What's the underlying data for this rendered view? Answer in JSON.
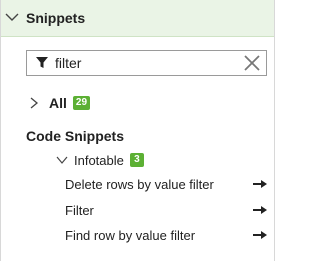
{
  "panel": {
    "title": "Snippets",
    "accent_color": "#5cb034",
    "header_bg": "#eaf4e6"
  },
  "search": {
    "value": "filter",
    "icon": "filter-icon",
    "clear_icon": "close-icon"
  },
  "all": {
    "label": "All",
    "count": "29"
  },
  "code_snippets": {
    "title": "Code Snippets",
    "group": {
      "label": "Infotable",
      "count": "3"
    },
    "items": [
      {
        "label": "Delete rows by value filter",
        "icon": "arrow-right-icon"
      },
      {
        "label": "Filter",
        "icon": "arrow-right-icon"
      },
      {
        "label": "Find row by value filter",
        "icon": "arrow-right-icon"
      }
    ]
  }
}
